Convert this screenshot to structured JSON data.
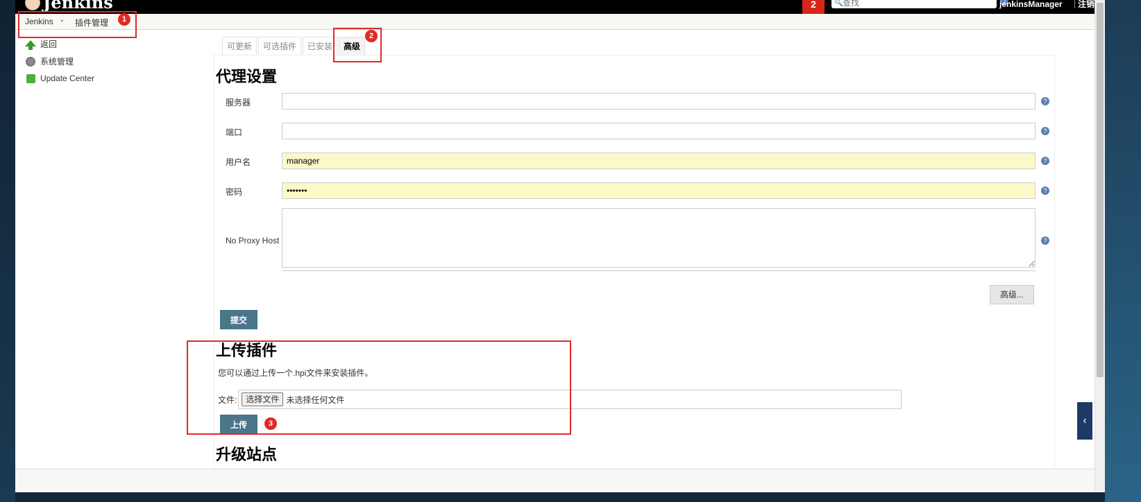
{
  "header": {
    "logo_text": "Jenkins",
    "badge": "2",
    "search_placeholder": "查找",
    "help": "?",
    "user": "jenkinsManager",
    "logout": "注销"
  },
  "breadcrumb": {
    "items": [
      "Jenkins",
      "插件管理"
    ],
    "separator": "▸"
  },
  "sidebar": {
    "items": [
      {
        "label": "返回",
        "icon": "arrow-up-icon"
      },
      {
        "label": "系统管理",
        "icon": "gear-icon"
      },
      {
        "label": "Update Center",
        "icon": "puzzle-icon"
      }
    ]
  },
  "tabs": [
    "可更新",
    "可选插件",
    "已安装",
    "高级"
  ],
  "proxy": {
    "title": "代理设置",
    "fields": [
      {
        "label": "服务器",
        "value": ""
      },
      {
        "label": "端口",
        "value": ""
      },
      {
        "label": "用户名",
        "value": "manager"
      },
      {
        "label": "密码",
        "value": "•••••••"
      }
    ],
    "no_proxy_label": "No Proxy Host",
    "no_proxy_value": "",
    "advanced_button": "高级...",
    "submit_button": "提交"
  },
  "upload": {
    "title": "上传插件",
    "description": "您可以通过上传一个.hpi文件来安装插件。",
    "file_label": "文件:",
    "choose_button": "选择文件",
    "no_file": "未选择任何文件",
    "upload_button": "上传"
  },
  "update_site": {
    "title": "升级站点"
  },
  "annotations": [
    "1",
    "2",
    "3"
  ],
  "colors": {
    "annotation": "#e02a27",
    "button": "#4b758b",
    "filled_input": "#fafac8"
  }
}
